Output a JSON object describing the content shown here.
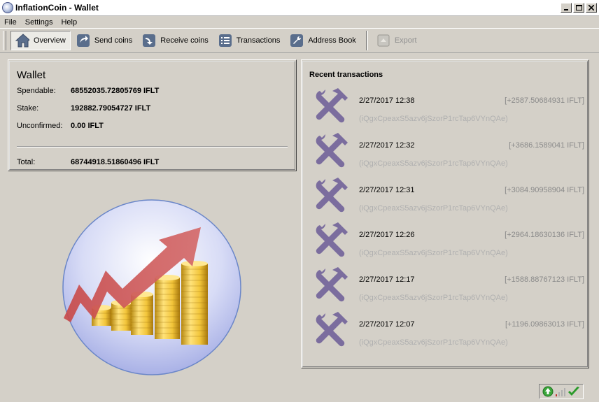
{
  "window": {
    "title": "InflationCoin - Wallet"
  },
  "menu": {
    "items": [
      "File",
      "Settings",
      "Help"
    ]
  },
  "toolbar": {
    "overview": "Overview",
    "send": "Send coins",
    "receive": "Receive coins",
    "transactions": "Transactions",
    "address_book": "Address Book",
    "export": "Export"
  },
  "wallet": {
    "title": "Wallet",
    "spendable_label": "Spendable:",
    "spendable": "68552035.72805769 IFLT",
    "stake_label": "Stake:",
    "stake": "192882.79054727 IFLT",
    "unconfirmed_label": "Unconfirmed:",
    "unconfirmed": "0.00 IFLT",
    "total_label": "Total:",
    "total": "68744918.51860496 IFLT"
  },
  "recent": {
    "title": "Recent transactions",
    "items": [
      {
        "date": "2/27/2017 12:38",
        "amount": "[+2587.50684931 IFLT]",
        "address": "(iQgxCpeaxS5azv6jSzorP1rcTap6VYnQAe)"
      },
      {
        "date": "2/27/2017 12:32",
        "amount": "[+3686.1589041 IFLT]",
        "address": "(iQgxCpeaxS5azv6jSzorP1rcTap6VYnQAe)"
      },
      {
        "date": "2/27/2017 12:31",
        "amount": "[+3084.90958904 IFLT]",
        "address": "(iQgxCpeaxS5azv6jSzorP1rcTap6VYnQAe)"
      },
      {
        "date": "2/27/2017 12:26",
        "amount": "[+2964.18630136 IFLT]",
        "address": "(iQgxCpeaxS5azv6jSzorP1rcTap6VYnQAe)"
      },
      {
        "date": "2/27/2017 12:17",
        "amount": "[+1588.88767123 IFLT]",
        "address": "(iQgxCpeaxS5azv6jSzorP1rcTap6VYnQAe)"
      },
      {
        "date": "2/27/2017 12:07",
        "amount": "[+1196.09863013 IFLT]",
        "address": "(iQgxCpeaxS5azv6jSzorP1rcTap6VYnQAe)"
      }
    ]
  },
  "icons": {
    "transaction": "tools-icon",
    "status_sync": "sync-status-icon",
    "status_signal": "signal-bars-icon",
    "status_ok": "checkmark-icon"
  },
  "colors": {
    "tx_icon": "#7b6d9e",
    "check": "#2a9a2a"
  }
}
